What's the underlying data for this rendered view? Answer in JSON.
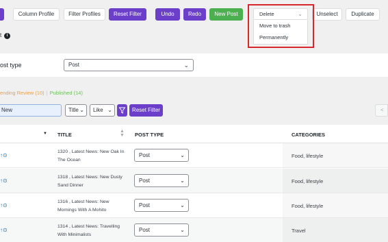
{
  "toolbar": {
    "buttons": [
      {
        "label": "",
        "style": "purple"
      },
      {
        "label": "Column Profile",
        "style": "white"
      },
      {
        "label": "Filter Profiles",
        "style": "white"
      },
      {
        "label": "Reset Filter",
        "style": "purple"
      },
      {
        "label": "Undo",
        "style": "purple"
      },
      {
        "label": "Redo",
        "style": "purple"
      },
      {
        "label": "New Post",
        "style": "green"
      },
      {
        "label": "Unselect",
        "style": "white"
      },
      {
        "label": "Duplicate",
        "style": "white"
      }
    ],
    "bulk_delete": {
      "selected": "Delete",
      "options": [
        "Move to trash",
        "Permanently"
      ]
    },
    "info_colon": "t"
  },
  "post_type_filter": {
    "label": "ost type",
    "selected": "Post"
  },
  "status_links": {
    "pending": "ending Review (10)",
    "separator": "|",
    "published": "Published (14)"
  },
  "search": {
    "value": "New",
    "field_select": "Title",
    "operator_select": "Like",
    "reset_label": "Reset Filter",
    "prev_page": "<"
  },
  "table": {
    "headers": {
      "title": "TITLE",
      "post_type": "POST TYPE",
      "categories": "CATEGORIES"
    },
    "rows": [
      {
        "title": "1320 , Latest News: New Oak In The Ocean",
        "post_type": "Post",
        "categories": "Food, lifestyle"
      },
      {
        "title": "1318 , Latest News: New Dusty Sand Dinner",
        "post_type": "Post",
        "categories": "Food, lifestyle"
      },
      {
        "title": "1316 , Latest News: New Mornings With A Mohito",
        "post_type": "Post",
        "categories": "Food, lifestyle"
      },
      {
        "title": "1314 , Latest News: Travelling With Minimalists",
        "post_type": "Post",
        "categories": "Travel"
      }
    ]
  },
  "colors": {
    "accent_purple": "#6b3fc9",
    "new_post_green": "#4caf50",
    "highlight_red": "#d9262c",
    "pending_orange": "#e9a04b",
    "published_green": "#6cbf5a"
  }
}
